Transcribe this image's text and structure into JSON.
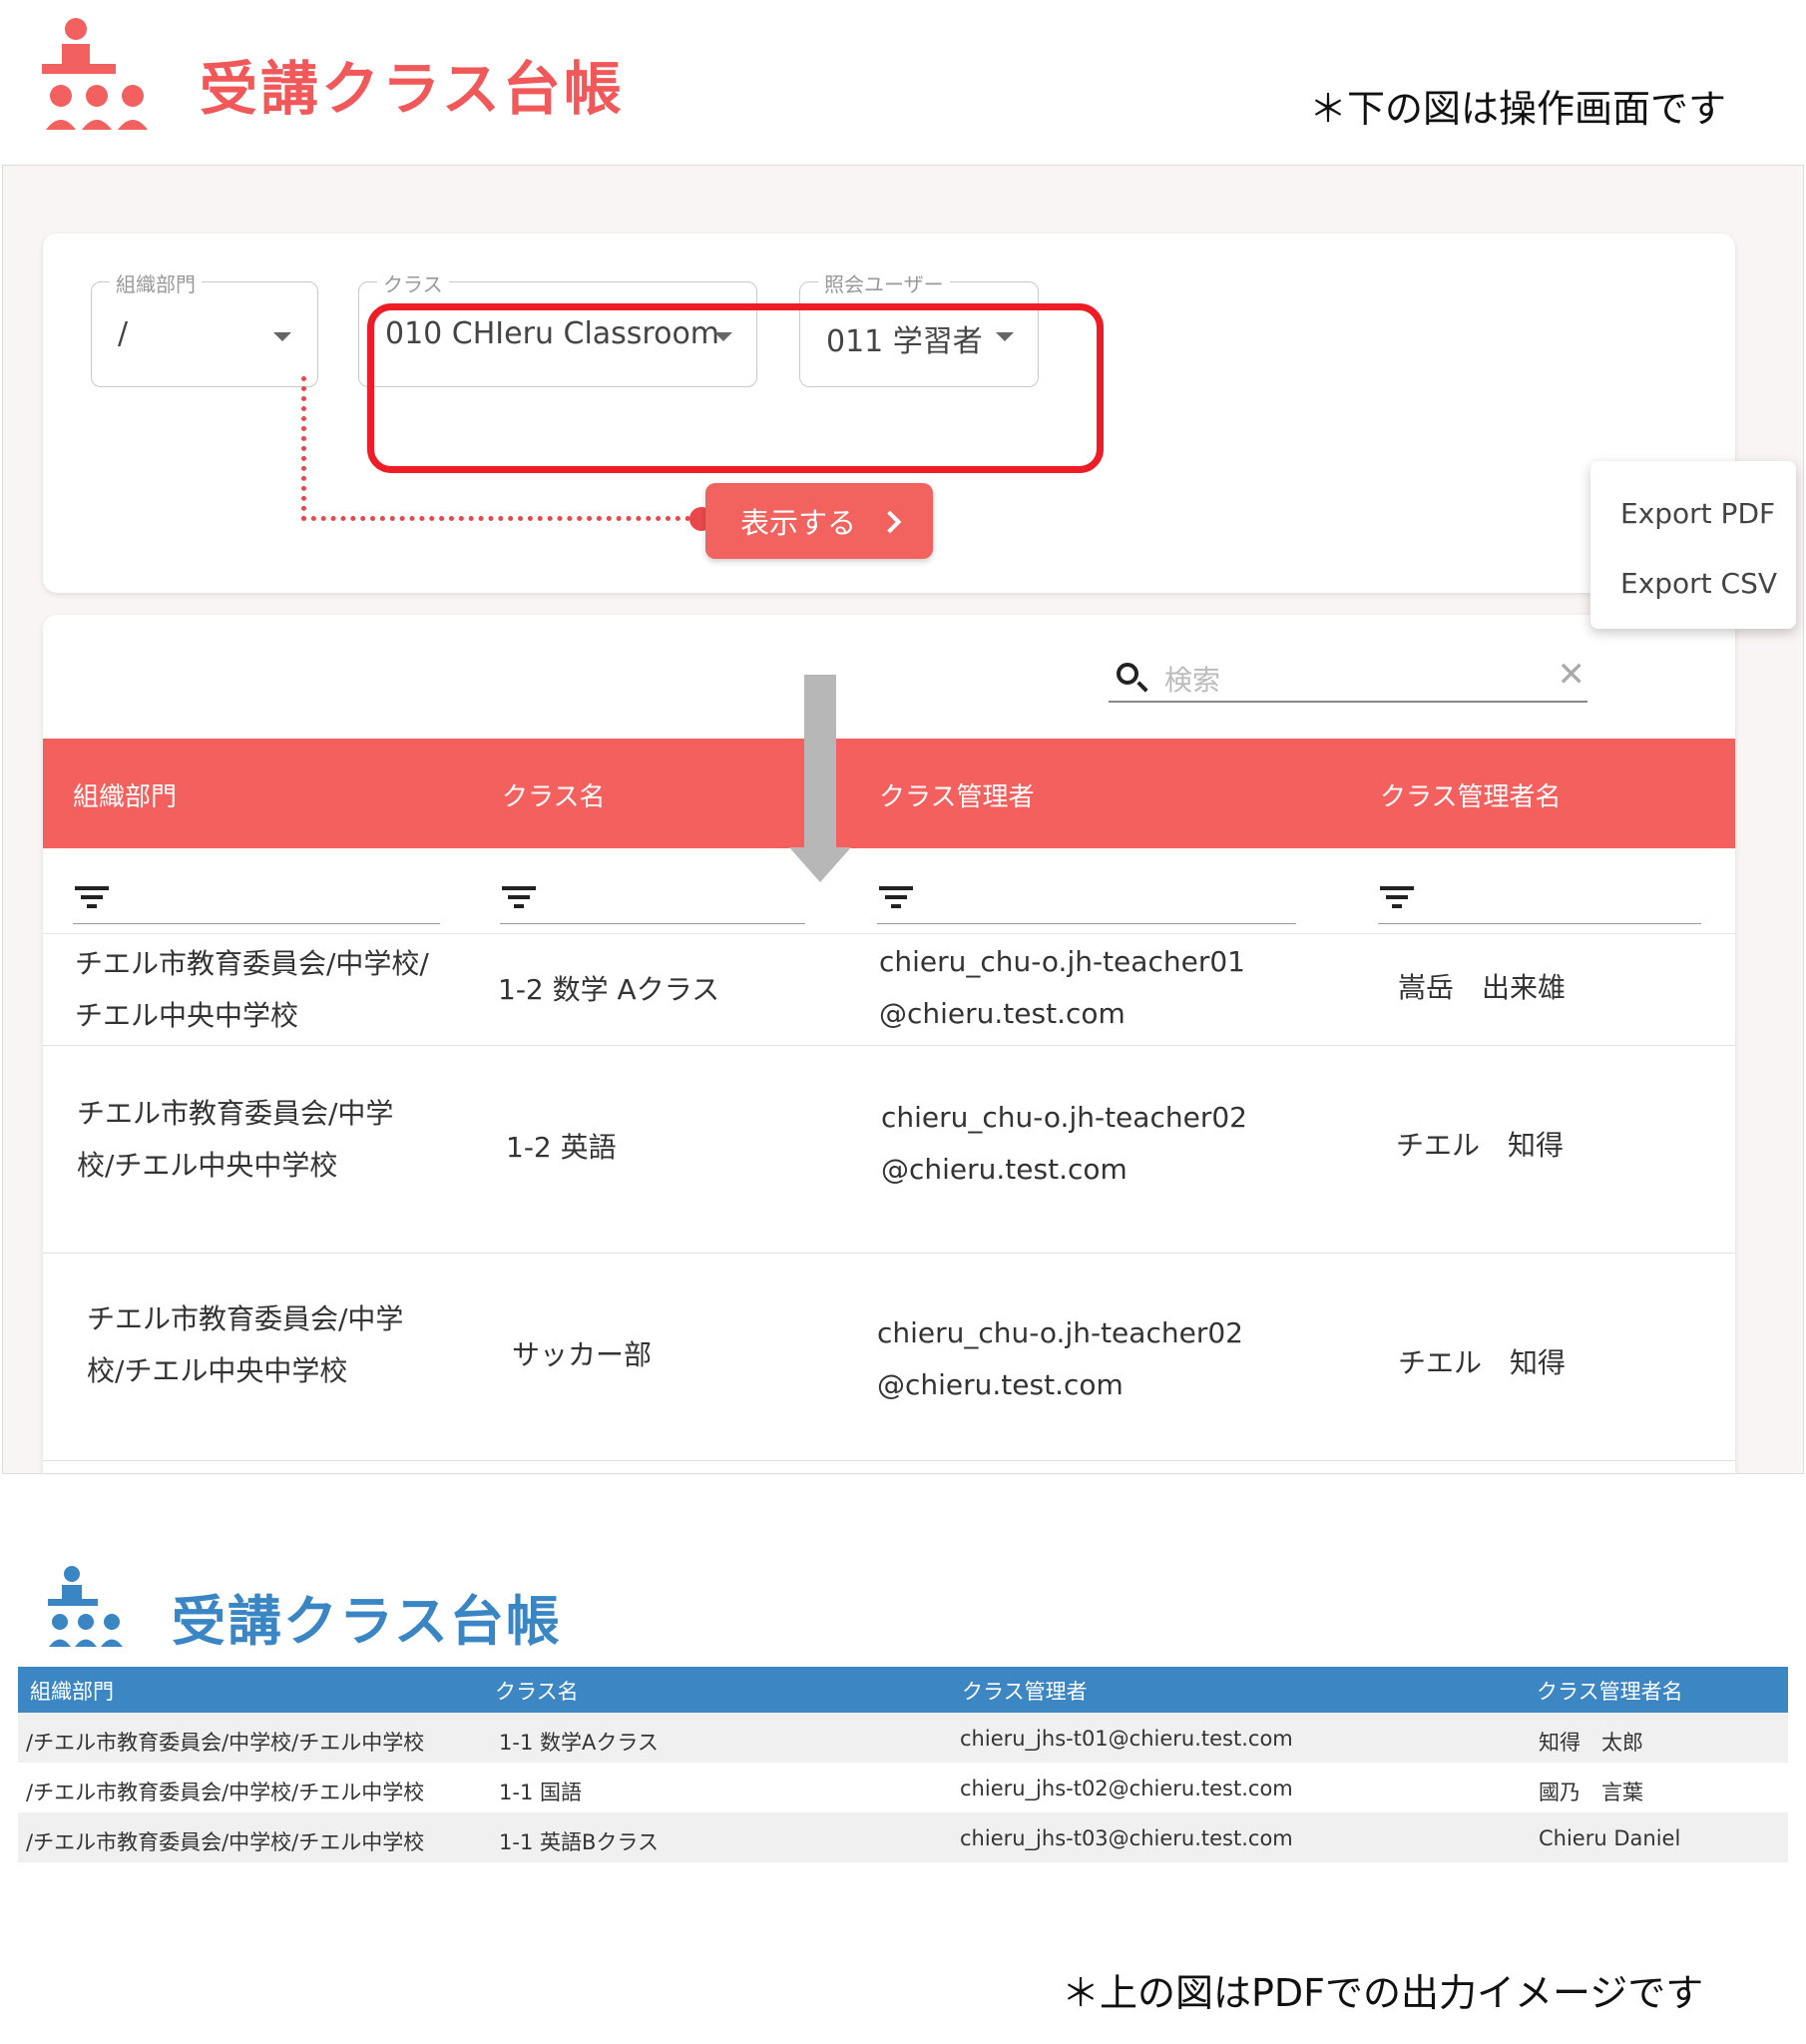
{
  "header": {
    "title": "受講クラス台帳",
    "note": "＊下の図は操作画面です"
  },
  "filters": {
    "org": {
      "label": "組織部門",
      "value": "/"
    },
    "class": {
      "label": "クラス",
      "value": "010 CHIeru Classroom"
    },
    "user": {
      "label": "照会ユーザー",
      "value": "011 学習者"
    },
    "show_button": "表示する"
  },
  "search": {
    "placeholder": "検索"
  },
  "export_menu": [
    "Export PDF",
    "Export CSV"
  ],
  "table": {
    "columns": [
      "組織部門",
      "クラス名",
      "クラス管理者",
      "クラス管理者名"
    ],
    "rows": [
      {
        "org": [
          "チエル市教育委員会/中学校/",
          "チエル中央中学校"
        ],
        "class": "1-2 数学 Aクラス",
        "admin": [
          "chieru_chu-o.jh-teacher01",
          "@chieru.test.com"
        ],
        "name": "嵩岳　出来雄"
      },
      {
        "org": [
          "チエル市教育委員会/中学",
          "校/チエル中央中学校"
        ],
        "class": "1-2 英語",
        "admin": [
          "chieru_chu-o.jh-teacher02",
          "@chieru.test.com"
        ],
        "name": "チエル　知得"
      },
      {
        "org": [
          "チエル市教育委員会/中学",
          "校/チエル中央中学校"
        ],
        "class": "サッカー部",
        "admin": [
          "chieru_chu-o.jh-teacher02",
          "@chieru.test.com"
        ],
        "name": "チエル　知得"
      }
    ]
  },
  "pdf": {
    "title": "受講クラス台帳",
    "columns": [
      "組織部門",
      "クラス名",
      "クラス管理者",
      "クラス管理者名"
    ],
    "rows": [
      {
        "org": "/チエル市教育委員会/中学校/チエル中学校",
        "class": "1-1 数学Aクラス",
        "admin": "chieru_jhs-t01@chieru.test.com",
        "name": "知得　太郎"
      },
      {
        "org": "/チエル市教育委員会/中学校/チエル中学校",
        "class": "1-1 国語",
        "admin": "chieru_jhs-t02@chieru.test.com",
        "name": "國乃　言葉"
      },
      {
        "org": "/チエル市教育委員会/中学校/チエル中学校",
        "class": "1-1 英語Bクラス",
        "admin": "chieru_jhs-t03@chieru.test.com",
        "name": "Chieru Daniel"
      }
    ],
    "note": "＊上の図はPDFでの出力イメージです"
  },
  "colors": {
    "accent_red": "#f4605e",
    "highlight_red": "#ee1c24",
    "pdf_blue": "#3c86c4"
  },
  "icons": [
    "class-people-icon",
    "search-icon",
    "clear-icon",
    "filter-icon",
    "chevron-right-icon",
    "dropdown-caret-icon"
  ]
}
